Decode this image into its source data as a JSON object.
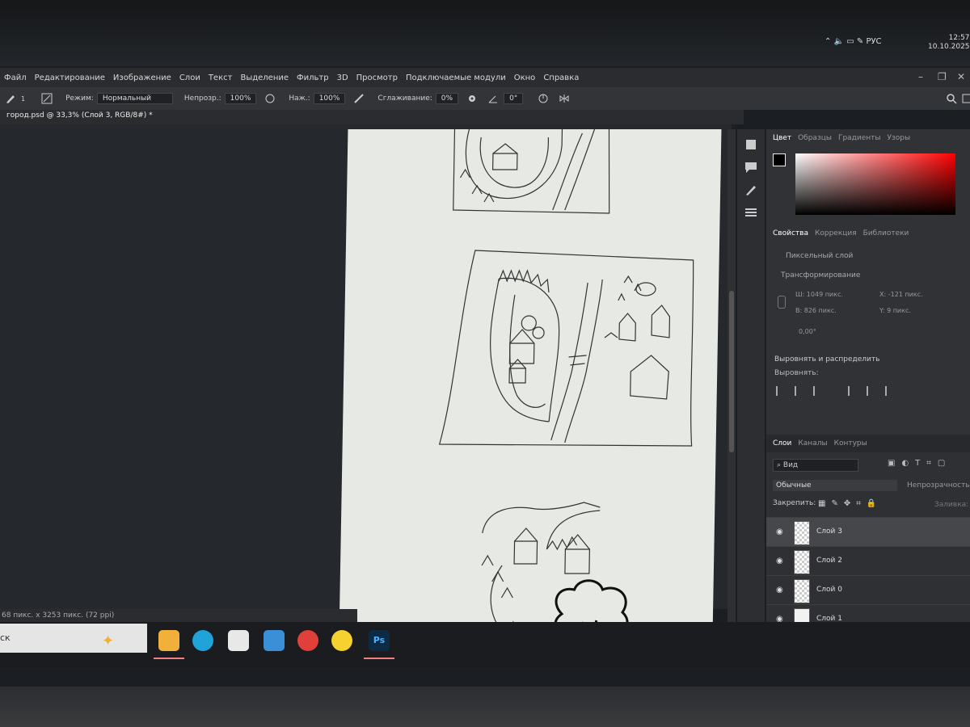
{
  "menu": [
    "Файл",
    "Редактирование",
    "Изображение",
    "Слои",
    "Текст",
    "Выделение",
    "Фильтр",
    "3D",
    "Просмотр",
    "Подключаемые модули",
    "Окно",
    "Справка"
  ],
  "options": {
    "brush_size": "1",
    "mode_label": "Режим:",
    "mode_value": "Нормальный",
    "opacity_label": "Непрозр.:",
    "opacity_value": "100%",
    "pressure_label": "Наж.:",
    "pressure_value": "100%",
    "smoothing_label": "Сглаживание:",
    "smoothing_value": "0%",
    "angle_value": "0°"
  },
  "document": {
    "tab_title": "город.psd @ 33,3% (Слой 3, RGB/8#) *",
    "status": "68 пикс. x 3253 пикс. (72 ppi)"
  },
  "color_panel": {
    "tabs": [
      "Цвет",
      "Образцы",
      "Градиенты",
      "Узоры"
    ]
  },
  "properties_panel": {
    "tabs": [
      "Свойства",
      "Коррекция",
      "Библиотеки"
    ],
    "pixel_layer": "Пиксельный слой",
    "transform": "Трансформирование",
    "w": "Ш: 1049 пикс.",
    "x": "X: -121 пикс.",
    "h": "В: 826 пикс.",
    "y": "Y: 9 пикс.",
    "angle": "0,00°",
    "align_title": "Выровнять и распределить",
    "align_sub": "Выровнять:"
  },
  "layers_panel": {
    "tabs": [
      "Слои",
      "Каналы",
      "Контуры"
    ],
    "search": "Вид",
    "blend_mode": "Обычные",
    "opacity_label": "Непрозрачность:",
    "lock_label": "Закрепить:",
    "fill_label": "Заливка:",
    "layers": [
      {
        "name": "Слой 3",
        "selected": true
      },
      {
        "name": "Слой 2",
        "selected": false
      },
      {
        "name": "Слой 0",
        "selected": false
      },
      {
        "name": "Слой 1",
        "selected": false
      }
    ]
  },
  "taskbar": {
    "search_text": "ск",
    "icons": [
      "file-explorer-icon",
      "edge-icon",
      "store-icon",
      "mail-icon",
      "yandex-icon",
      "yandex-market-icon",
      "photoshop-icon"
    ],
    "lang": "РУС",
    "time": "12:57",
    "date": "10.10.2025"
  }
}
